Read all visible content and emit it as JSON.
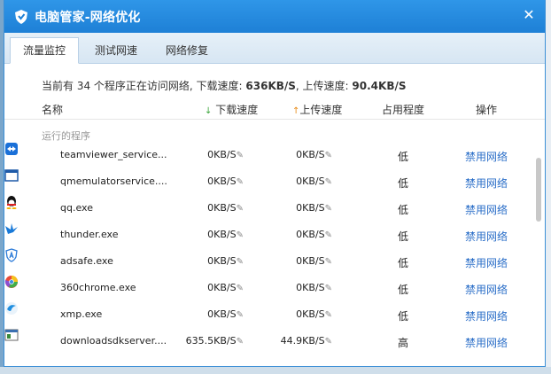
{
  "window": {
    "title": "电脑管家-网络优化",
    "close_glyph": "✕"
  },
  "tabs": [
    {
      "label": "流量监控",
      "active": true
    },
    {
      "label": "测试网速",
      "active": false
    },
    {
      "label": "网络修复",
      "active": false
    }
  ],
  "summary": {
    "prefix": "当前有 34 个程序正在访问网络, 下载速度: ",
    "download": "636KB/S",
    "middle": ", 上传速度: ",
    "upload": "90.4KB/S"
  },
  "columns": {
    "name": "名称",
    "download": "下载速度",
    "upload": "上传速度",
    "usage": "占用程度",
    "operation": "操作"
  },
  "section_label": "运行的程序",
  "rows": [
    {
      "icon": "teamviewer-icon",
      "name": "teamviewer_service...",
      "down": "0KB/S",
      "up": "0KB/S",
      "usage": "低",
      "action": "禁用网络"
    },
    {
      "icon": "window-icon",
      "name": "qmemulatorservice....",
      "down": "0KB/S",
      "up": "0KB/S",
      "usage": "低",
      "action": "禁用网络"
    },
    {
      "icon": "qq-icon",
      "name": "qq.exe",
      "down": "0KB/S",
      "up": "0KB/S",
      "usage": "低",
      "action": "禁用网络"
    },
    {
      "icon": "thunder-icon",
      "name": "thunder.exe",
      "down": "0KB/S",
      "up": "0KB/S",
      "usage": "低",
      "action": "禁用网络"
    },
    {
      "icon": "adsafe-icon",
      "name": "adsafe.exe",
      "down": "0KB/S",
      "up": "0KB/S",
      "usage": "低",
      "action": "禁用网络"
    },
    {
      "icon": "chrome-360-icon",
      "name": "360chrome.exe",
      "down": "0KB/S",
      "up": "0KB/S",
      "usage": "低",
      "action": "禁用网络"
    },
    {
      "icon": "xmp-icon",
      "name": "xmp.exe",
      "down": "0KB/S",
      "up": "0KB/S",
      "usage": "低",
      "action": "禁用网络"
    },
    {
      "icon": "downloadsdk-icon",
      "name": "downloadsdkserver....",
      "down": "635.5KB/S",
      "up": "44.9KB/S",
      "usage": "高",
      "action": "禁用网络"
    }
  ],
  "colors": {
    "title_bar": "#1e80d6",
    "link": "#2a6ec8",
    "download_arrow": "#3aa53a",
    "upload_arrow": "#e88a17"
  }
}
